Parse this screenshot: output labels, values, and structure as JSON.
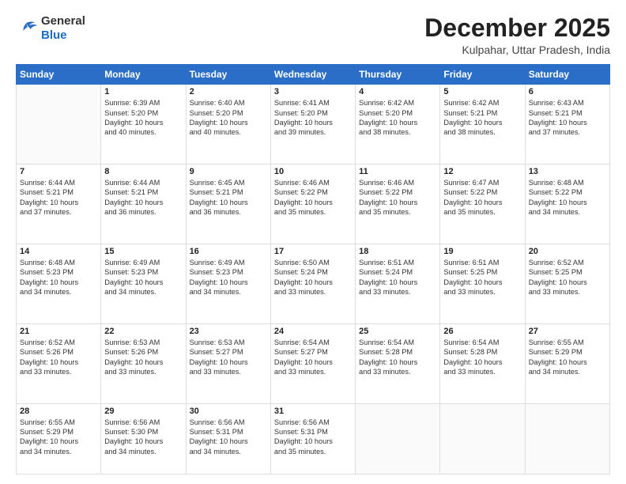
{
  "header": {
    "logo_general": "General",
    "logo_blue": "Blue",
    "month_title": "December 2025",
    "location": "Kulpahar, Uttar Pradesh, India"
  },
  "weekdays": [
    "Sunday",
    "Monday",
    "Tuesday",
    "Wednesday",
    "Thursday",
    "Friday",
    "Saturday"
  ],
  "weeks": [
    [
      {
        "day": "",
        "lines": []
      },
      {
        "day": "1",
        "lines": [
          "Sunrise: 6:39 AM",
          "Sunset: 5:20 PM",
          "Daylight: 10 hours",
          "and 40 minutes."
        ]
      },
      {
        "day": "2",
        "lines": [
          "Sunrise: 6:40 AM",
          "Sunset: 5:20 PM",
          "Daylight: 10 hours",
          "and 40 minutes."
        ]
      },
      {
        "day": "3",
        "lines": [
          "Sunrise: 6:41 AM",
          "Sunset: 5:20 PM",
          "Daylight: 10 hours",
          "and 39 minutes."
        ]
      },
      {
        "day": "4",
        "lines": [
          "Sunrise: 6:42 AM",
          "Sunset: 5:20 PM",
          "Daylight: 10 hours",
          "and 38 minutes."
        ]
      },
      {
        "day": "5",
        "lines": [
          "Sunrise: 6:42 AM",
          "Sunset: 5:21 PM",
          "Daylight: 10 hours",
          "and 38 minutes."
        ]
      },
      {
        "day": "6",
        "lines": [
          "Sunrise: 6:43 AM",
          "Sunset: 5:21 PM",
          "Daylight: 10 hours",
          "and 37 minutes."
        ]
      }
    ],
    [
      {
        "day": "7",
        "lines": [
          "Sunrise: 6:44 AM",
          "Sunset: 5:21 PM",
          "Daylight: 10 hours",
          "and 37 minutes."
        ]
      },
      {
        "day": "8",
        "lines": [
          "Sunrise: 6:44 AM",
          "Sunset: 5:21 PM",
          "Daylight: 10 hours",
          "and 36 minutes."
        ]
      },
      {
        "day": "9",
        "lines": [
          "Sunrise: 6:45 AM",
          "Sunset: 5:21 PM",
          "Daylight: 10 hours",
          "and 36 minutes."
        ]
      },
      {
        "day": "10",
        "lines": [
          "Sunrise: 6:46 AM",
          "Sunset: 5:22 PM",
          "Daylight: 10 hours",
          "and 35 minutes."
        ]
      },
      {
        "day": "11",
        "lines": [
          "Sunrise: 6:46 AM",
          "Sunset: 5:22 PM",
          "Daylight: 10 hours",
          "and 35 minutes."
        ]
      },
      {
        "day": "12",
        "lines": [
          "Sunrise: 6:47 AM",
          "Sunset: 5:22 PM",
          "Daylight: 10 hours",
          "and 35 minutes."
        ]
      },
      {
        "day": "13",
        "lines": [
          "Sunrise: 6:48 AM",
          "Sunset: 5:22 PM",
          "Daylight: 10 hours",
          "and 34 minutes."
        ]
      }
    ],
    [
      {
        "day": "14",
        "lines": [
          "Sunrise: 6:48 AM",
          "Sunset: 5:23 PM",
          "Daylight: 10 hours",
          "and 34 minutes."
        ]
      },
      {
        "day": "15",
        "lines": [
          "Sunrise: 6:49 AM",
          "Sunset: 5:23 PM",
          "Daylight: 10 hours",
          "and 34 minutes."
        ]
      },
      {
        "day": "16",
        "lines": [
          "Sunrise: 6:49 AM",
          "Sunset: 5:23 PM",
          "Daylight: 10 hours",
          "and 34 minutes."
        ]
      },
      {
        "day": "17",
        "lines": [
          "Sunrise: 6:50 AM",
          "Sunset: 5:24 PM",
          "Daylight: 10 hours",
          "and 33 minutes."
        ]
      },
      {
        "day": "18",
        "lines": [
          "Sunrise: 6:51 AM",
          "Sunset: 5:24 PM",
          "Daylight: 10 hours",
          "and 33 minutes."
        ]
      },
      {
        "day": "19",
        "lines": [
          "Sunrise: 6:51 AM",
          "Sunset: 5:25 PM",
          "Daylight: 10 hours",
          "and 33 minutes."
        ]
      },
      {
        "day": "20",
        "lines": [
          "Sunrise: 6:52 AM",
          "Sunset: 5:25 PM",
          "Daylight: 10 hours",
          "and 33 minutes."
        ]
      }
    ],
    [
      {
        "day": "21",
        "lines": [
          "Sunrise: 6:52 AM",
          "Sunset: 5:26 PM",
          "Daylight: 10 hours",
          "and 33 minutes."
        ]
      },
      {
        "day": "22",
        "lines": [
          "Sunrise: 6:53 AM",
          "Sunset: 5:26 PM",
          "Daylight: 10 hours",
          "and 33 minutes."
        ]
      },
      {
        "day": "23",
        "lines": [
          "Sunrise: 6:53 AM",
          "Sunset: 5:27 PM",
          "Daylight: 10 hours",
          "and 33 minutes."
        ]
      },
      {
        "day": "24",
        "lines": [
          "Sunrise: 6:54 AM",
          "Sunset: 5:27 PM",
          "Daylight: 10 hours",
          "and 33 minutes."
        ]
      },
      {
        "day": "25",
        "lines": [
          "Sunrise: 6:54 AM",
          "Sunset: 5:28 PM",
          "Daylight: 10 hours",
          "and 33 minutes."
        ]
      },
      {
        "day": "26",
        "lines": [
          "Sunrise: 6:54 AM",
          "Sunset: 5:28 PM",
          "Daylight: 10 hours",
          "and 33 minutes."
        ]
      },
      {
        "day": "27",
        "lines": [
          "Sunrise: 6:55 AM",
          "Sunset: 5:29 PM",
          "Daylight: 10 hours",
          "and 34 minutes."
        ]
      }
    ],
    [
      {
        "day": "28",
        "lines": [
          "Sunrise: 6:55 AM",
          "Sunset: 5:29 PM",
          "Daylight: 10 hours",
          "and 34 minutes."
        ]
      },
      {
        "day": "29",
        "lines": [
          "Sunrise: 6:56 AM",
          "Sunset: 5:30 PM",
          "Daylight: 10 hours",
          "and 34 minutes."
        ]
      },
      {
        "day": "30",
        "lines": [
          "Sunrise: 6:56 AM",
          "Sunset: 5:31 PM",
          "Daylight: 10 hours",
          "and 34 minutes."
        ]
      },
      {
        "day": "31",
        "lines": [
          "Sunrise: 6:56 AM",
          "Sunset: 5:31 PM",
          "Daylight: 10 hours",
          "and 35 minutes."
        ]
      },
      {
        "day": "",
        "lines": []
      },
      {
        "day": "",
        "lines": []
      },
      {
        "day": "",
        "lines": []
      }
    ]
  ]
}
